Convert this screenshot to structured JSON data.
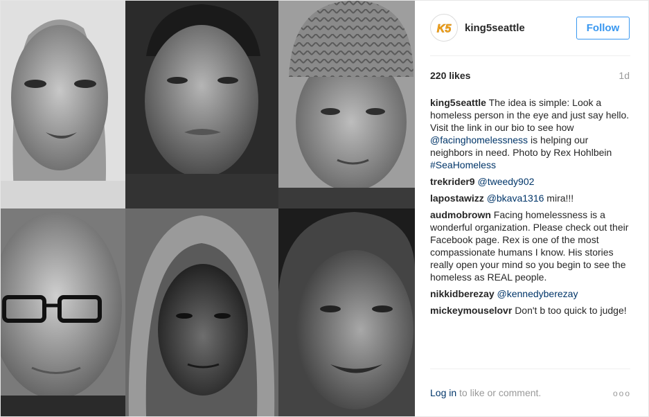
{
  "header": {
    "username": "king5seattle",
    "follow_label": "Follow",
    "avatar_text": "K5"
  },
  "post": {
    "likes": "220 likes",
    "time": "1d"
  },
  "caption": {
    "user": "king5seattle",
    "text_1": "The idea is simple: Look a homeless person in the eye and just say hello. Visit the link in our bio to see how",
    "mention": "@facinghomelessness",
    "text_2": "is helping our neighbors in need. Photo by Rex Hohlbein",
    "hashtag": "#SeaHomeless"
  },
  "comments": [
    {
      "user": "trekrider9",
      "mention": "@tweedy902",
      "text": ""
    },
    {
      "user": "lapostawizz",
      "mention": "@bkava1316",
      "text": "mira!!!"
    },
    {
      "user": "audmobrown",
      "mention": "",
      "text": "Facing homelessness is a wonderful organization. Please check out their Facebook page. Rex is one of the most compassionate humans I know. His stories really open your mind so you begin to see the homeless as REAL people."
    },
    {
      "user": "nikkidberezay",
      "mention": "@kennedyberezay",
      "text": ""
    },
    {
      "user": "mickeymouselovr",
      "mention": "",
      "text": "Don't b too quick to judge!"
    }
  ],
  "footer": {
    "login_label": "Log in",
    "text": "to like or comment.",
    "more": "ooo"
  },
  "colors": {
    "accent": "#3897f0",
    "link": "#003569",
    "muted": "#999999",
    "logo_orange": "#f5a623"
  }
}
